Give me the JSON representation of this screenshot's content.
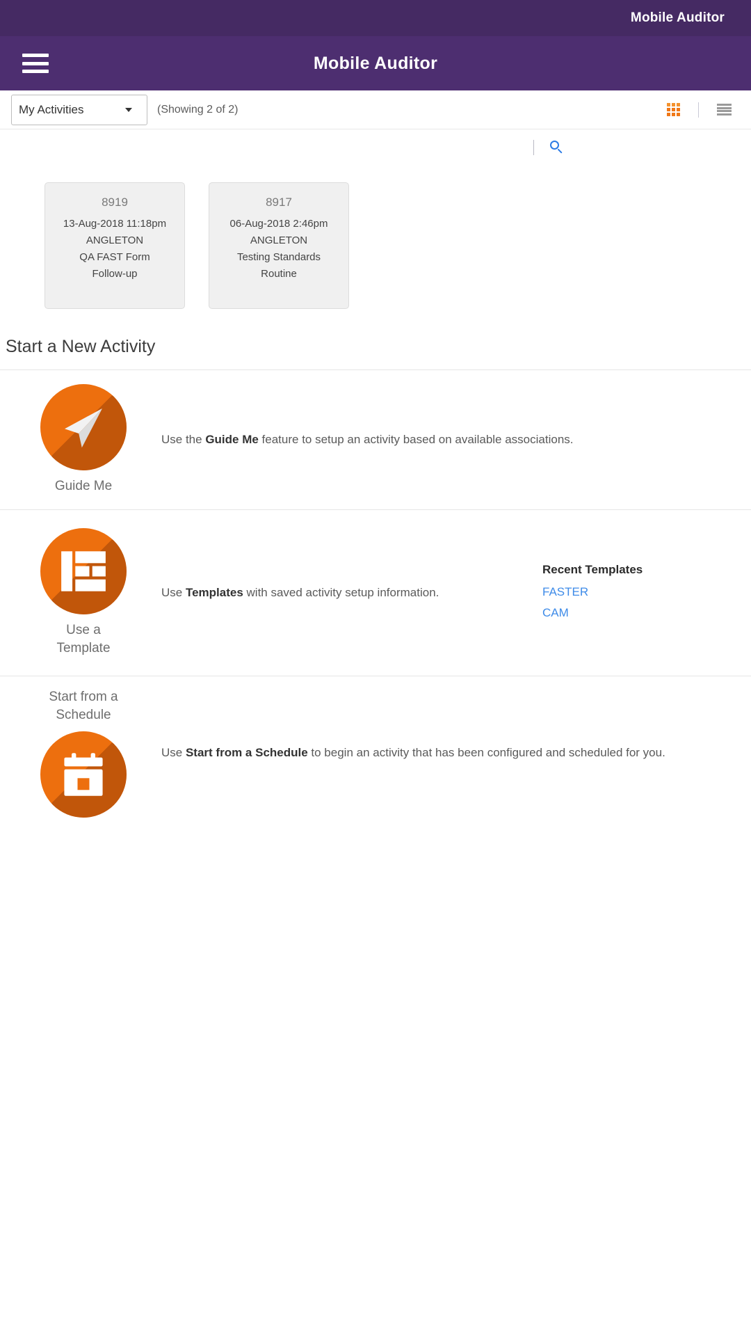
{
  "brandbar": {
    "title": "Mobile Auditor"
  },
  "appbar": {
    "title": "Mobile Auditor",
    "menu_icon": "hamburger-menu-icon"
  },
  "filterbar": {
    "selected_filter": "My Activities",
    "filter_options": [
      "My Activities"
    ],
    "showing_count": "(Showing 2 of 2)",
    "grid_view_icon": "grid-view-icon",
    "list_view_icon": "list-view-icon",
    "active_view": "grid"
  },
  "searchrow": {
    "search_icon": "search-icon"
  },
  "activities": [
    {
      "id": "8919",
      "datetime": "13-Aug-2018 11:18pm",
      "location": "ANGLETON",
      "form": "QA FAST Form",
      "type": "Follow-up"
    },
    {
      "id": "8917",
      "datetime": "06-Aug-2018 2:46pm",
      "location": "ANGLETON",
      "form": "Testing Standards",
      "type": "Routine"
    }
  ],
  "new_activity": {
    "section_title": "Start a New Activity",
    "guide_me": {
      "label": "Guide Me",
      "icon": "paper-plane-icon",
      "desc_pre": "Use the ",
      "desc_bold": "Guide Me",
      "desc_post": " feature to setup an activity based on available associations."
    },
    "template": {
      "label_line1": "Use a",
      "label_line2": "Template",
      "icon": "template-layout-icon",
      "desc_pre": "Use ",
      "desc_bold": "Templates",
      "desc_post": " with saved activity setup information.",
      "recent_title": "Recent Templates",
      "recent_items": [
        "FASTER",
        "CAM"
      ]
    },
    "schedule": {
      "label_line1": "Start from a",
      "label_line2": "Schedule",
      "icon": "calendar-icon",
      "desc_pre": "Use ",
      "desc_bold": "Start from a Schedule",
      "desc_post": " to begin an activity that has been configured and scheduled for you."
    }
  },
  "colors": {
    "brand_purple_dark": "#452A63",
    "brand_purple": "#4D2E70",
    "accent_orange": "#ED6F0E",
    "link_blue": "#3E8BE8",
    "search_blue": "#2C7BE5"
  }
}
